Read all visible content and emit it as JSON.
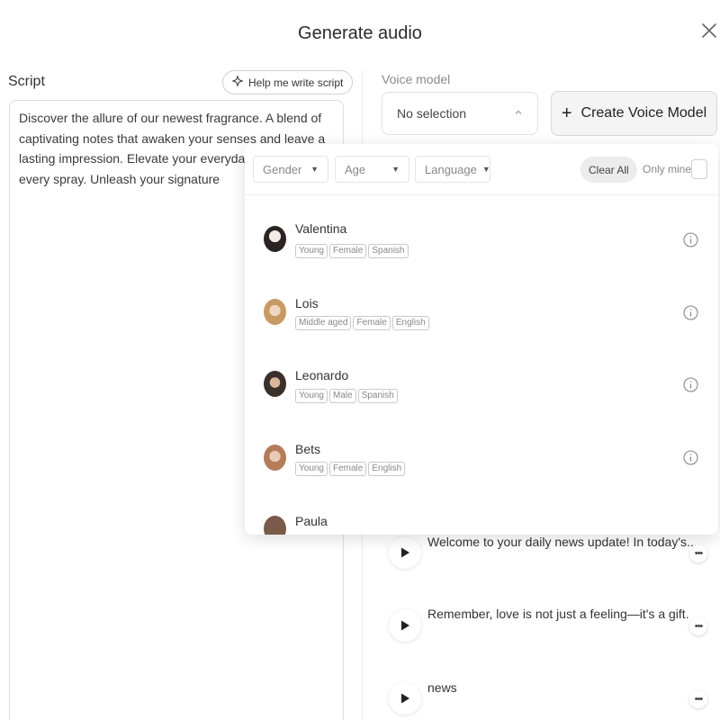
{
  "modal": {
    "title": "Generate audio"
  },
  "script": {
    "label": "Script",
    "help_button": "Help me write script",
    "text": "Discover the allure of our newest fragrance. A blend of captivating notes that awaken your senses and leave a lasting impression. Elevate your everyday — luxury in every spray. Unleash your signature"
  },
  "voice_model": {
    "label": "Voice model",
    "selected": "No selection",
    "create_button": "Create Voice Model"
  },
  "dropdown": {
    "filters": {
      "gender": "Gender",
      "age": "Age",
      "language": "Language",
      "clear_all": "Clear All",
      "only_mine": "Only mine"
    },
    "voices": [
      {
        "name": "Valentina",
        "tags": [
          "Young",
          "Female",
          "Spanish"
        ]
      },
      {
        "name": "Lois",
        "tags": [
          "Middle aged",
          "Female",
          "English"
        ]
      },
      {
        "name": "Leonardo",
        "tags": [
          "Young",
          "Male",
          "Spanish"
        ]
      },
      {
        "name": "Bets",
        "tags": [
          "Young",
          "Female",
          "English"
        ]
      },
      {
        "name": "Paula",
        "tags": []
      }
    ]
  },
  "samples": [
    {
      "text": "Welcome to your daily news update! In today's..."
    },
    {
      "text": "Remember, love is not just a feeling—it's a gift."
    },
    {
      "text": "news"
    }
  ],
  "colors": {
    "accent_bg": "#f4f4f4",
    "border": "#dedede",
    "muted_text": "#888888"
  }
}
